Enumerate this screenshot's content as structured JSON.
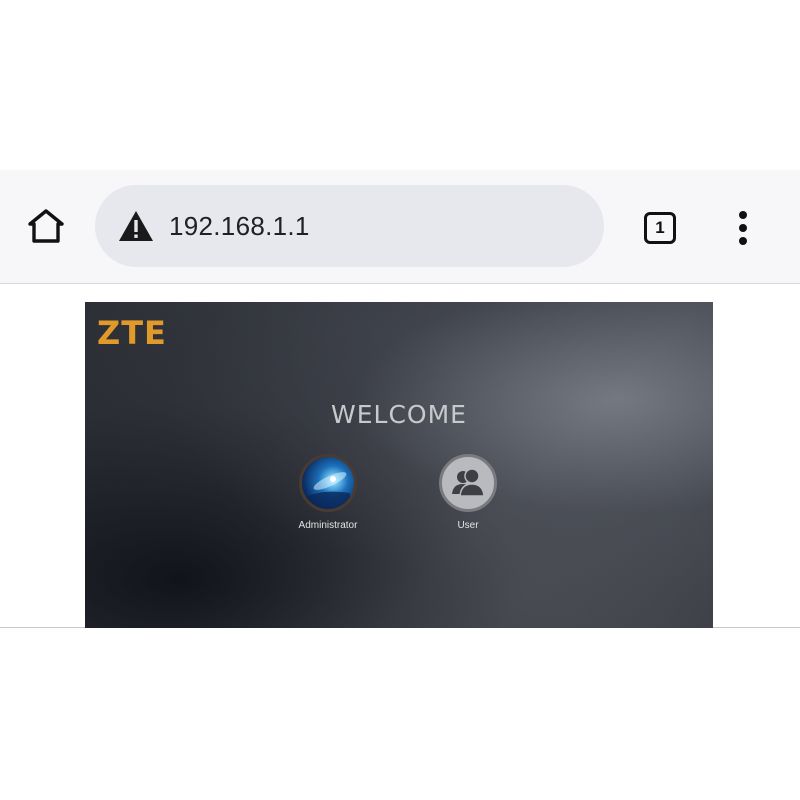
{
  "browser": {
    "url": "192.168.1.1",
    "tab_count": "1",
    "icons": {
      "home": "home-icon",
      "warning": "warning-icon",
      "tabs": "tabs-icon",
      "menu": "more-vert-icon"
    }
  },
  "router_page": {
    "brand": "ZTE",
    "brand_color": "#e19a2a",
    "welcome": "WELCOME",
    "accounts": [
      {
        "label": "Administrator",
        "icon": "admin-avatar-icon"
      },
      {
        "label": "User",
        "icon": "user-group-icon"
      }
    ]
  }
}
